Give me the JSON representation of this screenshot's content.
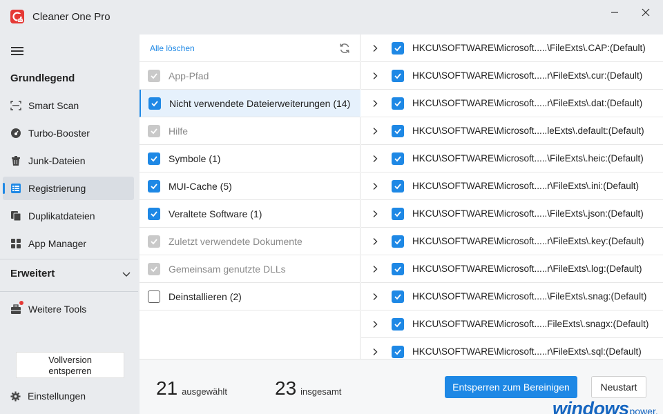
{
  "app": {
    "title": "Cleaner One Pro",
    "window_controls": [
      "minimize-icon",
      "close-icon"
    ]
  },
  "sidebar": {
    "section_basic": "Grundlegend",
    "items": [
      {
        "label": "Smart Scan",
        "icon": "scan-icon",
        "active": false
      },
      {
        "label": "Turbo-Booster",
        "icon": "speedometer-icon",
        "active": false
      },
      {
        "label": "Junk-Dateien",
        "icon": "trash-icon",
        "active": false
      },
      {
        "label": "Registrierung",
        "icon": "registry-icon",
        "active": true
      },
      {
        "label": "Duplikatdateien",
        "icon": "duplicate-icon",
        "active": false
      },
      {
        "label": "App Manager",
        "icon": "apps-grid-icon",
        "active": false
      }
    ],
    "section_advanced": "Erweitert",
    "more_tools": "Weitere Tools",
    "unlock_label_line1": "Vollversion",
    "unlock_label_line2": "entsperren",
    "settings": "Einstellungen"
  },
  "categories": {
    "clear_all": "Alle löschen",
    "items": [
      {
        "label": "App-Pfad",
        "state": "disabled"
      },
      {
        "label": "Nicht verwendete Dateierweiterungen (14)",
        "state": "checked",
        "selected": true
      },
      {
        "label": "Hilfe",
        "state": "disabled"
      },
      {
        "label": "Symbole (1)",
        "state": "checked"
      },
      {
        "label": "MUI-Cache (5)",
        "state": "checked"
      },
      {
        "label": "Veraltete Software (1)",
        "state": "checked"
      },
      {
        "label": "Zuletzt verwendete Dokumente",
        "state": "disabled"
      },
      {
        "label": "Gemeinsam genutzte DLLs",
        "state": "disabled"
      },
      {
        "label": "Deinstallieren (2)",
        "state": "unchecked"
      }
    ]
  },
  "entries": [
    "HKCU\\SOFTWARE\\Microsoft.....\\FileExts\\.CAP:(Default)",
    "HKCU\\SOFTWARE\\Microsoft.....r\\FileExts\\.cur:(Default)",
    "HKCU\\SOFTWARE\\Microsoft.....r\\FileExts\\.dat:(Default)",
    "HKCU\\SOFTWARE\\Microsoft.....leExts\\.default:(Default)",
    "HKCU\\SOFTWARE\\Microsoft.....\\FileExts\\.heic:(Default)",
    "HKCU\\SOFTWARE\\Microsoft.....r\\FileExts\\.ini:(Default)",
    "HKCU\\SOFTWARE\\Microsoft.....\\FileExts\\.json:(Default)",
    "HKCU\\SOFTWARE\\Microsoft.....r\\FileExts\\.key:(Default)",
    "HKCU\\SOFTWARE\\Microsoft.....r\\FileExts\\.log:(Default)",
    "HKCU\\SOFTWARE\\Microsoft.....\\FileExts\\.snag:(Default)",
    "HKCU\\SOFTWARE\\Microsoft.....FileExts\\.snagx:(Default)",
    "HKCU\\SOFTWARE\\Microsoft.....r\\FileExts\\.sql:(Default)"
  ],
  "footer": {
    "selected_count": "21",
    "selected_label": "ausgewählt",
    "total_count": "23",
    "total_label": "insgesamt",
    "primary_button": "Entsperren zum Bereinigen",
    "secondary_button": "Neustart"
  },
  "watermark": {
    "main": "windows",
    "sub": "power."
  },
  "colors": {
    "accent": "#1e88e5",
    "brand_red": "#e53935"
  }
}
